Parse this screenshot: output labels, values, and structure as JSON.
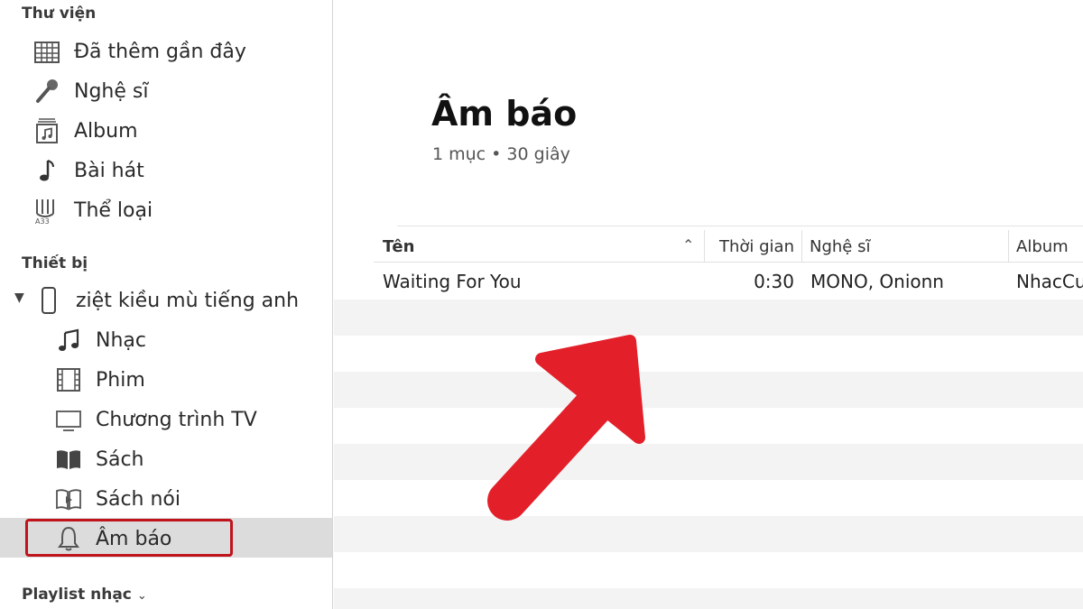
{
  "sidebar": {
    "library_title": "Thư viện",
    "library_items": [
      {
        "label": "Đã thêm gần đây",
        "icon": "recently-added-icon"
      },
      {
        "label": "Nghệ sĩ",
        "icon": "microphone-icon"
      },
      {
        "label": "Album",
        "icon": "album-icon"
      },
      {
        "label": "Bài hát",
        "icon": "music-note-icon"
      },
      {
        "label": "Thể loại",
        "icon": "genre-icon"
      }
    ],
    "devices_title": "Thiết bị",
    "device_name": "ziệt kiều mù tiếng anh",
    "device_items": [
      {
        "label": "Nhạc",
        "icon": "music-icon"
      },
      {
        "label": "Phim",
        "icon": "film-icon"
      },
      {
        "label": "Chương trình TV",
        "icon": "tv-icon"
      },
      {
        "label": "Sách",
        "icon": "book-icon"
      },
      {
        "label": "Sách nói",
        "icon": "audiobook-icon"
      },
      {
        "label": "Âm báo",
        "icon": "bell-icon",
        "selected": true
      }
    ],
    "playlist_title": "Playlist nhạc"
  },
  "main": {
    "title": "Âm báo",
    "subtitle": "1 mục • 30 giây",
    "columns": [
      "Tên",
      "Thời gian",
      "Nghệ sĩ",
      "Album"
    ],
    "rows": [
      {
        "name": "Waiting For You",
        "time": "0:30",
        "artist": "MONO, Onionn",
        "album": "NhacCu"
      }
    ]
  },
  "colors": {
    "highlight": "#c0141c",
    "arrow": "#e3202a",
    "selected_bg": "#dcdcdc",
    "alt_row": "#f3f3f3"
  }
}
